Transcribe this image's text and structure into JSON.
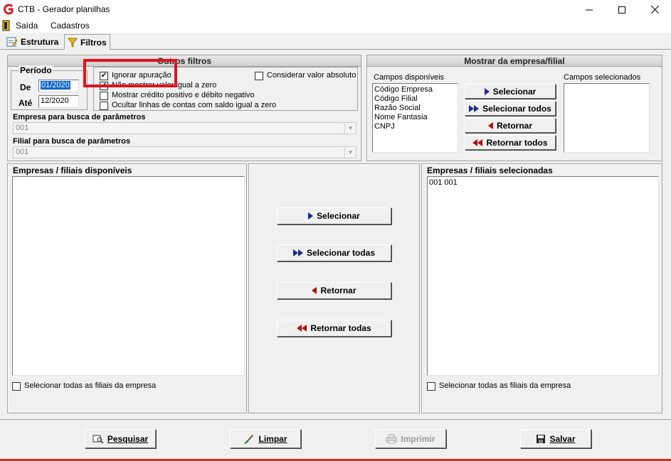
{
  "window": {
    "title": "CTB - Gerador planilhas",
    "minimize": "—",
    "maximize": "☐",
    "close": "✕"
  },
  "menu": [
    {
      "label": "Saída"
    },
    {
      "label": "Cadastros"
    }
  ],
  "tabs": [
    {
      "label": "Estrutura"
    },
    {
      "label": "Filtros"
    }
  ],
  "periodo": {
    "title": "Período",
    "de_label": "De",
    "de_value": "01/2020",
    "ate_label": "Até",
    "ate_value": "12/2020"
  },
  "outros_filtros": {
    "title": "Outros filtros",
    "ignorar_apuracao": {
      "label": "Ignorar apuração",
      "checked": true
    },
    "nao_mostrar_valor_zero": {
      "label": "Não mostrar valor igual a zero",
      "checked": true
    },
    "considerar_valor_absoluto": {
      "label": "Considerar valor absoluto",
      "checked": false
    },
    "mostrar_credito_positivo": {
      "label": "Mostrar crédito positivo e débito negativo",
      "checked": false
    },
    "ocultar_linhas_saldo_zero": {
      "label": "Ocultar linhas de contas com saldo igual a zero",
      "checked": false
    }
  },
  "empresa_busca": {
    "label": "Empresa para busca de parâmetros",
    "value": "001"
  },
  "filial_busca": {
    "label": "Filial para busca de parâmetros",
    "value": "001"
  },
  "mostrar_empresa": {
    "title": "Mostrar da empresa/filial",
    "campos_disponiveis_label": "Campos disponíveis",
    "campos_disponiveis": [
      "Código Empresa",
      "Código Filial",
      "Razão Social",
      "Nome Fantasia",
      "CNPJ"
    ],
    "campos_selecionados_label": "Campos selecionados",
    "buttons": {
      "selecionar": "Selecionar",
      "selecionar_todos": "Selecionar todos",
      "retornar": "Retornar",
      "retornar_todos": "Retornar todos"
    }
  },
  "empresas_disponiveis": {
    "label": "Empresas / filiais disponíveis",
    "items": [],
    "check_label": "Selecionar todas as filiais da empresa"
  },
  "middle_buttons": {
    "selecionar": "Selecionar",
    "selecionar_todas": "Selecionar todas",
    "retornar": "Retornar",
    "retornar_todas": "Retornar todas"
  },
  "empresas_selecionadas": {
    "label": "Empresas / filiais selecionadas",
    "items": [
      "001 001"
    ],
    "check_label": "Selecionar todas as filiais da empresa"
  },
  "footer": {
    "pesquisar": "Pesquisar",
    "limpar": "Limpar",
    "imprimir": "Imprimir",
    "salvar": "Salvar"
  },
  "colors": {
    "highlight_box": "#e0141e",
    "selection": "#0a64c8",
    "arrow_right": "#1a2a8a",
    "arrow_left": "#b01010"
  }
}
